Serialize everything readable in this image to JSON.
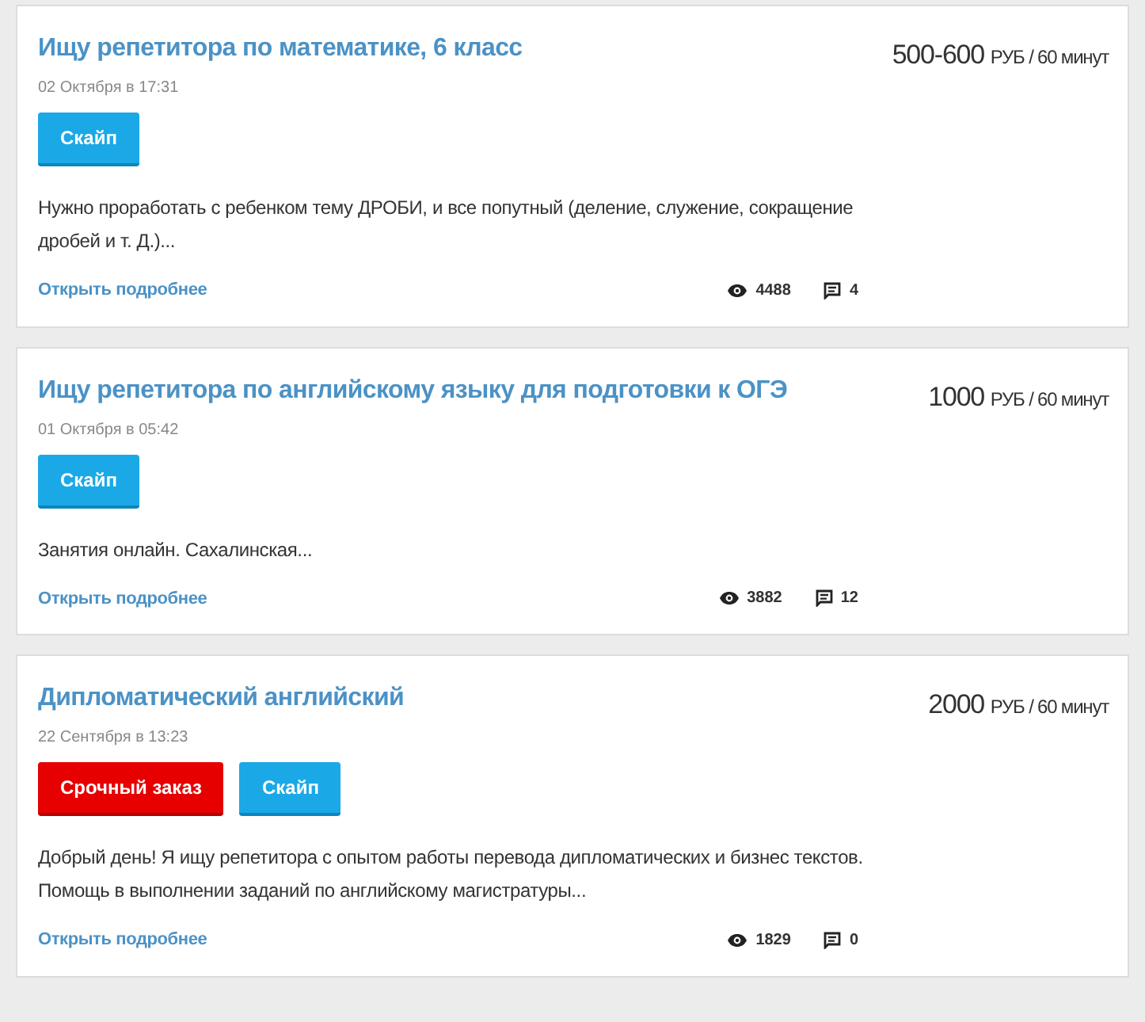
{
  "orders": [
    {
      "title": "Ищу репетитора по математике, 6 класс",
      "date": "02 Октября в 17:31",
      "price_amount": "500-600",
      "price_unit": "РУБ / 60 минут",
      "tags": [
        {
          "kind": "skype",
          "label": "Скайп"
        }
      ],
      "description": "Нужно проработать с ребенком тему ДРОБИ, и все попутный (деление, служение, сокращение дробей и т. Д.)...",
      "link": "Открыть подробнее",
      "views": "4488",
      "comments": "4"
    },
    {
      "title": "Ищу репетитора по английскому языку для подготовки к ОГЭ",
      "date": "01 Октября в 05:42",
      "price_amount": "1000",
      "price_unit": "РУБ / 60 минут",
      "tags": [
        {
          "kind": "skype",
          "label": "Скайп"
        }
      ],
      "description": "Занятия онлайн. Сахалинская...",
      "link": "Открыть подробнее",
      "views": "3882",
      "comments": "12"
    },
    {
      "title": "Дипломатический английский",
      "date": "22 Сентября в 13:23",
      "price_amount": "2000",
      "price_unit": "РУБ / 60 минут",
      "tags": [
        {
          "kind": "urgent",
          "label": "Срочный заказ"
        },
        {
          "kind": "skype",
          "label": "Скайп"
        }
      ],
      "description": "Добрый день! Я ищу репетитора с опытом работы перевода дипломатических и бизнес текстов. Помощь в выполнении заданий по английскому магистратуры...",
      "link": "Открыть подробнее",
      "views": "1829",
      "comments": "0"
    }
  ]
}
